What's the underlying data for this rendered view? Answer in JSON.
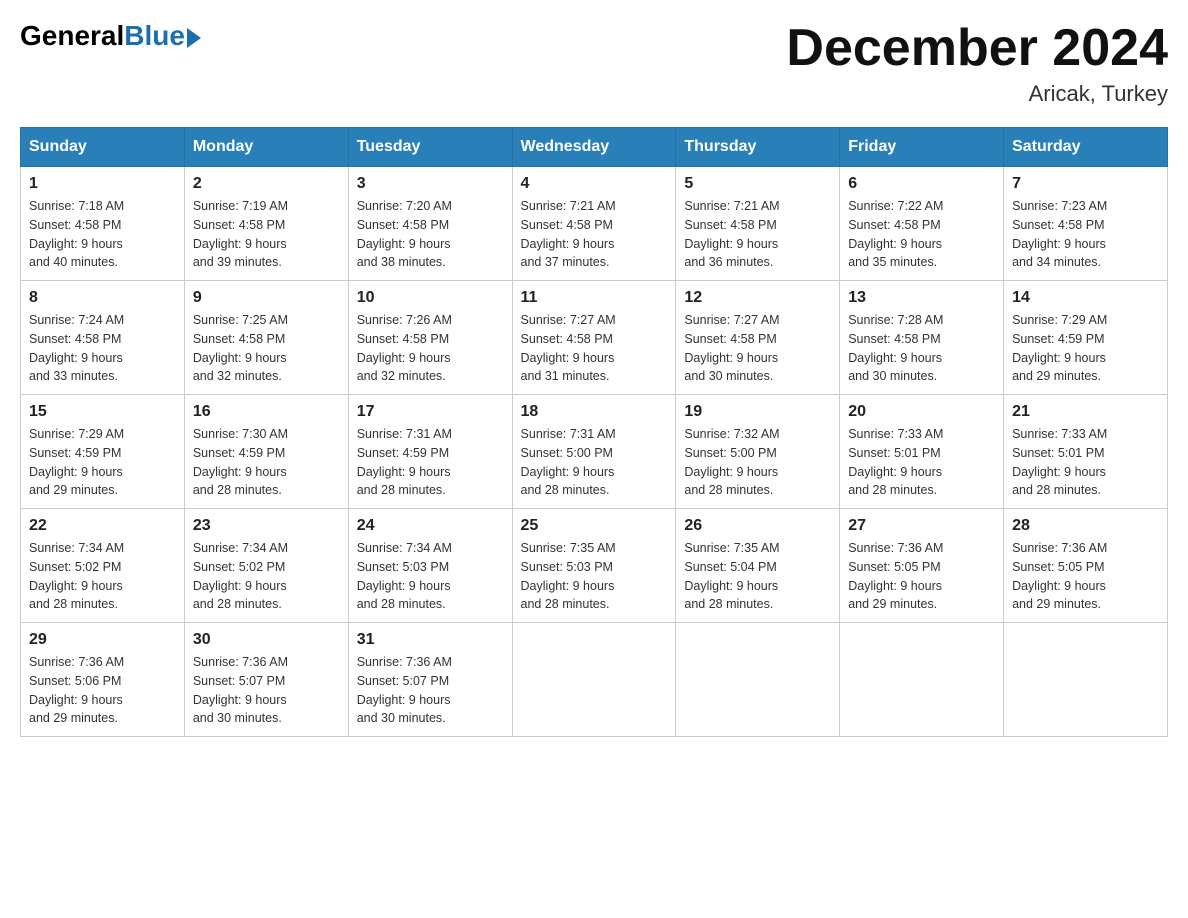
{
  "header": {
    "logo_general": "General",
    "logo_blue": "Blue",
    "month_title": "December 2024",
    "location": "Aricak, Turkey"
  },
  "days_of_week": [
    "Sunday",
    "Monday",
    "Tuesday",
    "Wednesday",
    "Thursday",
    "Friday",
    "Saturday"
  ],
  "weeks": [
    [
      {
        "day": "1",
        "sunrise": "7:18 AM",
        "sunset": "4:58 PM",
        "daylight": "9 hours and 40 minutes."
      },
      {
        "day": "2",
        "sunrise": "7:19 AM",
        "sunset": "4:58 PM",
        "daylight": "9 hours and 39 minutes."
      },
      {
        "day": "3",
        "sunrise": "7:20 AM",
        "sunset": "4:58 PM",
        "daylight": "9 hours and 38 minutes."
      },
      {
        "day": "4",
        "sunrise": "7:21 AM",
        "sunset": "4:58 PM",
        "daylight": "9 hours and 37 minutes."
      },
      {
        "day": "5",
        "sunrise": "7:21 AM",
        "sunset": "4:58 PM",
        "daylight": "9 hours and 36 minutes."
      },
      {
        "day": "6",
        "sunrise": "7:22 AM",
        "sunset": "4:58 PM",
        "daylight": "9 hours and 35 minutes."
      },
      {
        "day": "7",
        "sunrise": "7:23 AM",
        "sunset": "4:58 PM",
        "daylight": "9 hours and 34 minutes."
      }
    ],
    [
      {
        "day": "8",
        "sunrise": "7:24 AM",
        "sunset": "4:58 PM",
        "daylight": "9 hours and 33 minutes."
      },
      {
        "day": "9",
        "sunrise": "7:25 AM",
        "sunset": "4:58 PM",
        "daylight": "9 hours and 32 minutes."
      },
      {
        "day": "10",
        "sunrise": "7:26 AM",
        "sunset": "4:58 PM",
        "daylight": "9 hours and 32 minutes."
      },
      {
        "day": "11",
        "sunrise": "7:27 AM",
        "sunset": "4:58 PM",
        "daylight": "9 hours and 31 minutes."
      },
      {
        "day": "12",
        "sunrise": "7:27 AM",
        "sunset": "4:58 PM",
        "daylight": "9 hours and 30 minutes."
      },
      {
        "day": "13",
        "sunrise": "7:28 AM",
        "sunset": "4:58 PM",
        "daylight": "9 hours and 30 minutes."
      },
      {
        "day": "14",
        "sunrise": "7:29 AM",
        "sunset": "4:59 PM",
        "daylight": "9 hours and 29 minutes."
      }
    ],
    [
      {
        "day": "15",
        "sunrise": "7:29 AM",
        "sunset": "4:59 PM",
        "daylight": "9 hours and 29 minutes."
      },
      {
        "day": "16",
        "sunrise": "7:30 AM",
        "sunset": "4:59 PM",
        "daylight": "9 hours and 28 minutes."
      },
      {
        "day": "17",
        "sunrise": "7:31 AM",
        "sunset": "4:59 PM",
        "daylight": "9 hours and 28 minutes."
      },
      {
        "day": "18",
        "sunrise": "7:31 AM",
        "sunset": "5:00 PM",
        "daylight": "9 hours and 28 minutes."
      },
      {
        "day": "19",
        "sunrise": "7:32 AM",
        "sunset": "5:00 PM",
        "daylight": "9 hours and 28 minutes."
      },
      {
        "day": "20",
        "sunrise": "7:33 AM",
        "sunset": "5:01 PM",
        "daylight": "9 hours and 28 minutes."
      },
      {
        "day": "21",
        "sunrise": "7:33 AM",
        "sunset": "5:01 PM",
        "daylight": "9 hours and 28 minutes."
      }
    ],
    [
      {
        "day": "22",
        "sunrise": "7:34 AM",
        "sunset": "5:02 PM",
        "daylight": "9 hours and 28 minutes."
      },
      {
        "day": "23",
        "sunrise": "7:34 AM",
        "sunset": "5:02 PM",
        "daylight": "9 hours and 28 minutes."
      },
      {
        "day": "24",
        "sunrise": "7:34 AM",
        "sunset": "5:03 PM",
        "daylight": "9 hours and 28 minutes."
      },
      {
        "day": "25",
        "sunrise": "7:35 AM",
        "sunset": "5:03 PM",
        "daylight": "9 hours and 28 minutes."
      },
      {
        "day": "26",
        "sunrise": "7:35 AM",
        "sunset": "5:04 PM",
        "daylight": "9 hours and 28 minutes."
      },
      {
        "day": "27",
        "sunrise": "7:36 AM",
        "sunset": "5:05 PM",
        "daylight": "9 hours and 29 minutes."
      },
      {
        "day": "28",
        "sunrise": "7:36 AM",
        "sunset": "5:05 PM",
        "daylight": "9 hours and 29 minutes."
      }
    ],
    [
      {
        "day": "29",
        "sunrise": "7:36 AM",
        "sunset": "5:06 PM",
        "daylight": "9 hours and 29 minutes."
      },
      {
        "day": "30",
        "sunrise": "7:36 AM",
        "sunset": "5:07 PM",
        "daylight": "9 hours and 30 minutes."
      },
      {
        "day": "31",
        "sunrise": "7:36 AM",
        "sunset": "5:07 PM",
        "daylight": "9 hours and 30 minutes."
      },
      null,
      null,
      null,
      null
    ]
  ],
  "labels": {
    "sunrise": "Sunrise:",
    "sunset": "Sunset:",
    "daylight": "Daylight:"
  }
}
